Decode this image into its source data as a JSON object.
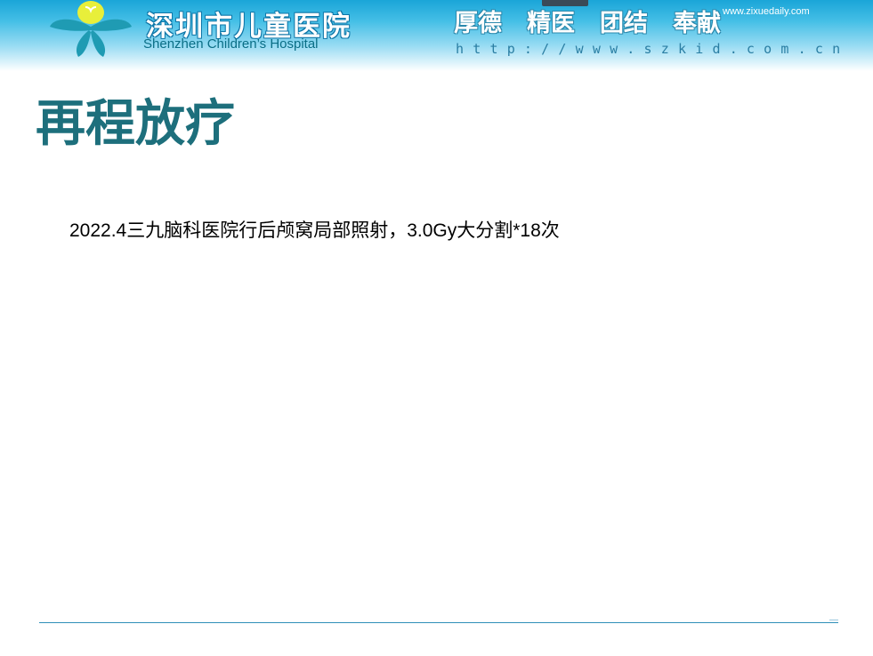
{
  "header": {
    "hospital_name_cn": "深圳市儿童医院",
    "hospital_name_en": "Shenzhen Children’s Hospital",
    "slogan": [
      "厚德",
      "精医",
      "团结",
      "奉献"
    ],
    "url": "http://www.szkid.com.cn",
    "watermark": "www.zixuedaily.com",
    "brand_color": "#1aa5d8"
  },
  "slide": {
    "title": "再程放疗",
    "body": "2022.4三九脑科医院行后颅窝局部照射，3.0Gy大分割*18次",
    "title_color": "#1d6f7c"
  },
  "icons": {
    "logo": "children-hospital-logo-icon"
  }
}
